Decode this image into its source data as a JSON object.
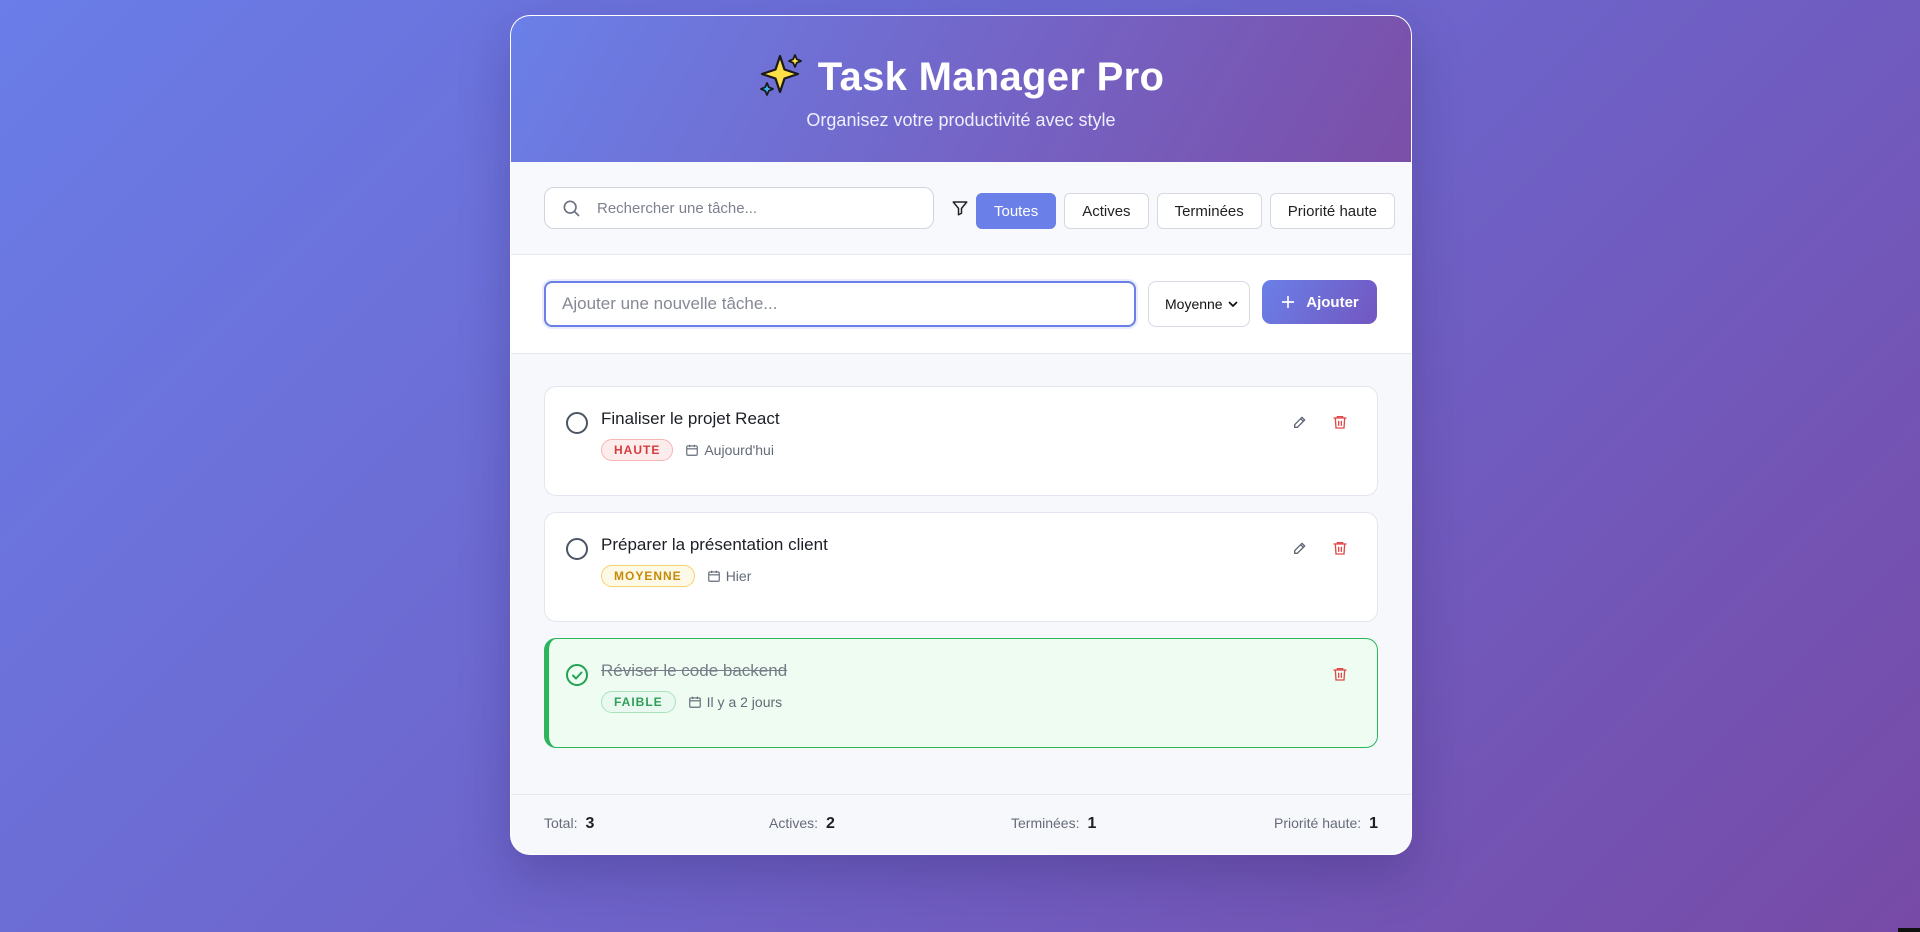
{
  "header": {
    "title": "Task Manager Pro",
    "title_icon": "sparkles-icon",
    "subtitle": "Organisez votre productivité avec style"
  },
  "search": {
    "placeholder": "Rechercher une tâche...",
    "value": ""
  },
  "filters": [
    {
      "label": "Toutes",
      "active": true
    },
    {
      "label": "Actives",
      "active": false
    },
    {
      "label": "Terminées",
      "active": false
    },
    {
      "label": "Priorité haute",
      "active": false
    }
  ],
  "new_task": {
    "placeholder": "Ajouter une nouvelle tâche...",
    "value": "",
    "priority_selected": "Moyenne",
    "add_label": "Ajouter"
  },
  "tasks": [
    {
      "title": "Finaliser le projet React",
      "priority": "HAUTE",
      "date": "Aujourd'hui",
      "completed": false
    },
    {
      "title": "Préparer la présentation client",
      "priority": "MOYENNE",
      "date": "Hier",
      "completed": false
    },
    {
      "title": "Réviser le code backend",
      "priority": "FAIBLE",
      "date": "Il y a 2 jours",
      "completed": true
    }
  ],
  "stats": {
    "total_label": "Total:",
    "total": "3",
    "active_label": "Actives:",
    "active": "2",
    "done_label": "Terminées:",
    "done": "1",
    "high_label": "Priorité haute:",
    "high": "1"
  },
  "colors": {
    "accent": "#6a80e8",
    "accent_dark": "#7356c0",
    "high": "#d63b3b",
    "medium": "#c58a07",
    "low": "#2f9e59",
    "done_border": "#2db55d"
  }
}
